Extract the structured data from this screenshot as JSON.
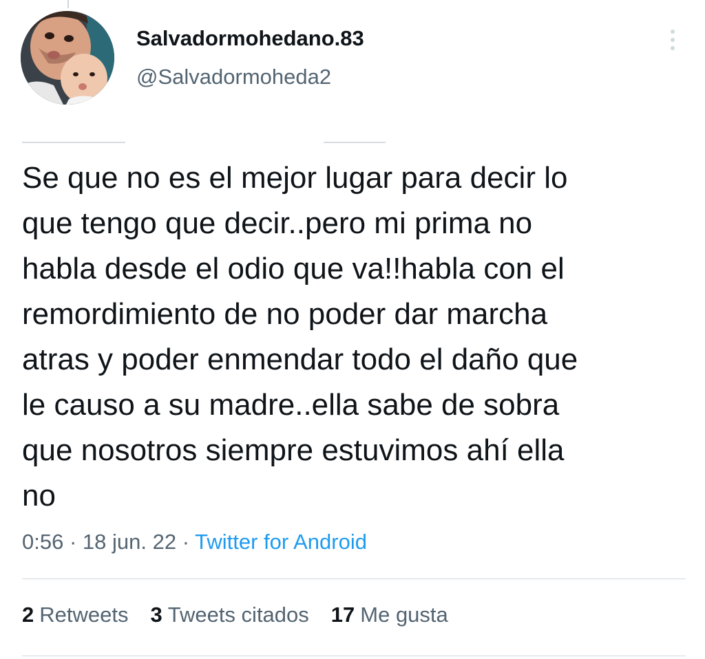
{
  "user": {
    "display_name": "Salvadormohedano.83",
    "handle": "@Salvadormoheda2"
  },
  "tweet": {
    "text": "Se que no es el mejor lugar para decir lo\nque tengo que decir..pero mi prima no\nhabla desde el odio que va!!habla con el\nremordimiento de no poder dar marcha\natras y poder enmendar todo el daño que\nle causo a su madre..ella sabe de sobra\nque nosotros siempre estuvimos ahí ella\nno",
    "time": "0:56",
    "separator": "·",
    "date": "18 jun. 22",
    "source": "Twitter for Android"
  },
  "stats": {
    "retweets_count": "2",
    "retweets_label": "Retweets",
    "quotes_count": "3",
    "quotes_label": "Tweets citados",
    "likes_count": "17",
    "likes_label": "Me gusta"
  },
  "icons": {
    "more": "more-vertical-icon"
  },
  "colors": {
    "text_primary": "#0f1419",
    "text_secondary": "#536471",
    "link": "#1d9bf0",
    "divider": "#cfd9de"
  }
}
